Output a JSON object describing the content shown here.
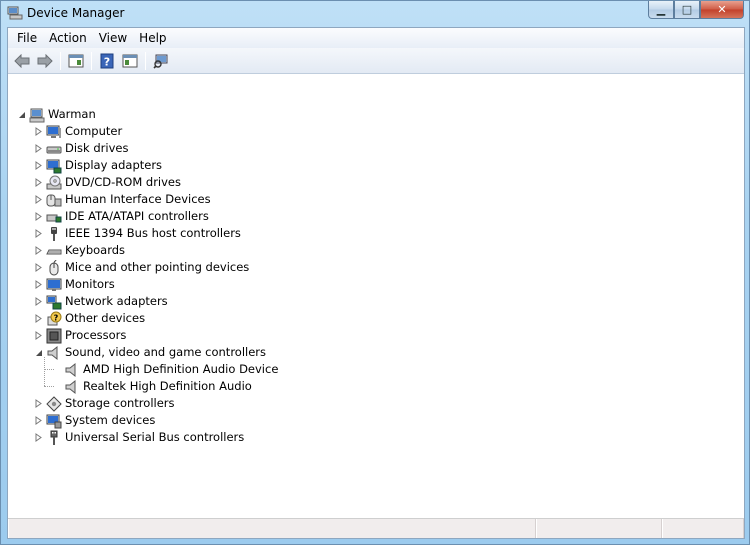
{
  "window": {
    "title": "Device Manager",
    "minimize_glyph": "▁",
    "maximize_glyph": "□",
    "close_glyph": "✕"
  },
  "menu": [
    "File",
    "Action",
    "View",
    "Help"
  ],
  "toolbar": {
    "buttons": [
      "back-icon",
      "forward-icon",
      "properties-pane-icon",
      "help-icon",
      "console-tree-icon",
      "scan-hardware-icon"
    ]
  },
  "tree": {
    "root": "Warman",
    "categories": [
      {
        "label": "Computer",
        "icon": "computer-icon",
        "expanded": false
      },
      {
        "label": "Disk drives",
        "icon": "disk-drive-icon",
        "expanded": false
      },
      {
        "label": "Display adapters",
        "icon": "display-adapter-icon",
        "expanded": false
      },
      {
        "label": "DVD/CD-ROM drives",
        "icon": "dvd-drive-icon",
        "expanded": false
      },
      {
        "label": "Human Interface Devices",
        "icon": "hid-icon",
        "expanded": false
      },
      {
        "label": "IDE ATA/ATAPI controllers",
        "icon": "ide-controller-icon",
        "expanded": false
      },
      {
        "label": "IEEE 1394 Bus host controllers",
        "icon": "ieee1394-icon",
        "expanded": false
      },
      {
        "label": "Keyboards",
        "icon": "keyboard-icon",
        "expanded": false
      },
      {
        "label": "Mice and other pointing devices",
        "icon": "mouse-icon",
        "expanded": false
      },
      {
        "label": "Monitors",
        "icon": "monitor-icon",
        "expanded": false
      },
      {
        "label": "Network adapters",
        "icon": "network-adapter-icon",
        "expanded": false
      },
      {
        "label": "Other devices",
        "icon": "other-devices-icon",
        "expanded": false
      },
      {
        "label": "Processors",
        "icon": "processor-icon",
        "expanded": false
      },
      {
        "label": "Sound, video and game controllers",
        "icon": "speaker-icon",
        "expanded": true,
        "children": [
          "AMD High Definition Audio Device",
          "Realtek High Definition Audio"
        ]
      },
      {
        "label": "Storage controllers",
        "icon": "storage-controller-icon",
        "expanded": false
      },
      {
        "label": "System devices",
        "icon": "system-devices-icon",
        "expanded": false
      },
      {
        "label": "Universal Serial Bus controllers",
        "icon": "usb-icon",
        "expanded": false
      }
    ]
  },
  "colors": {
    "title_gradient": "#a8d2f0",
    "status_bg": "#f1eded"
  }
}
